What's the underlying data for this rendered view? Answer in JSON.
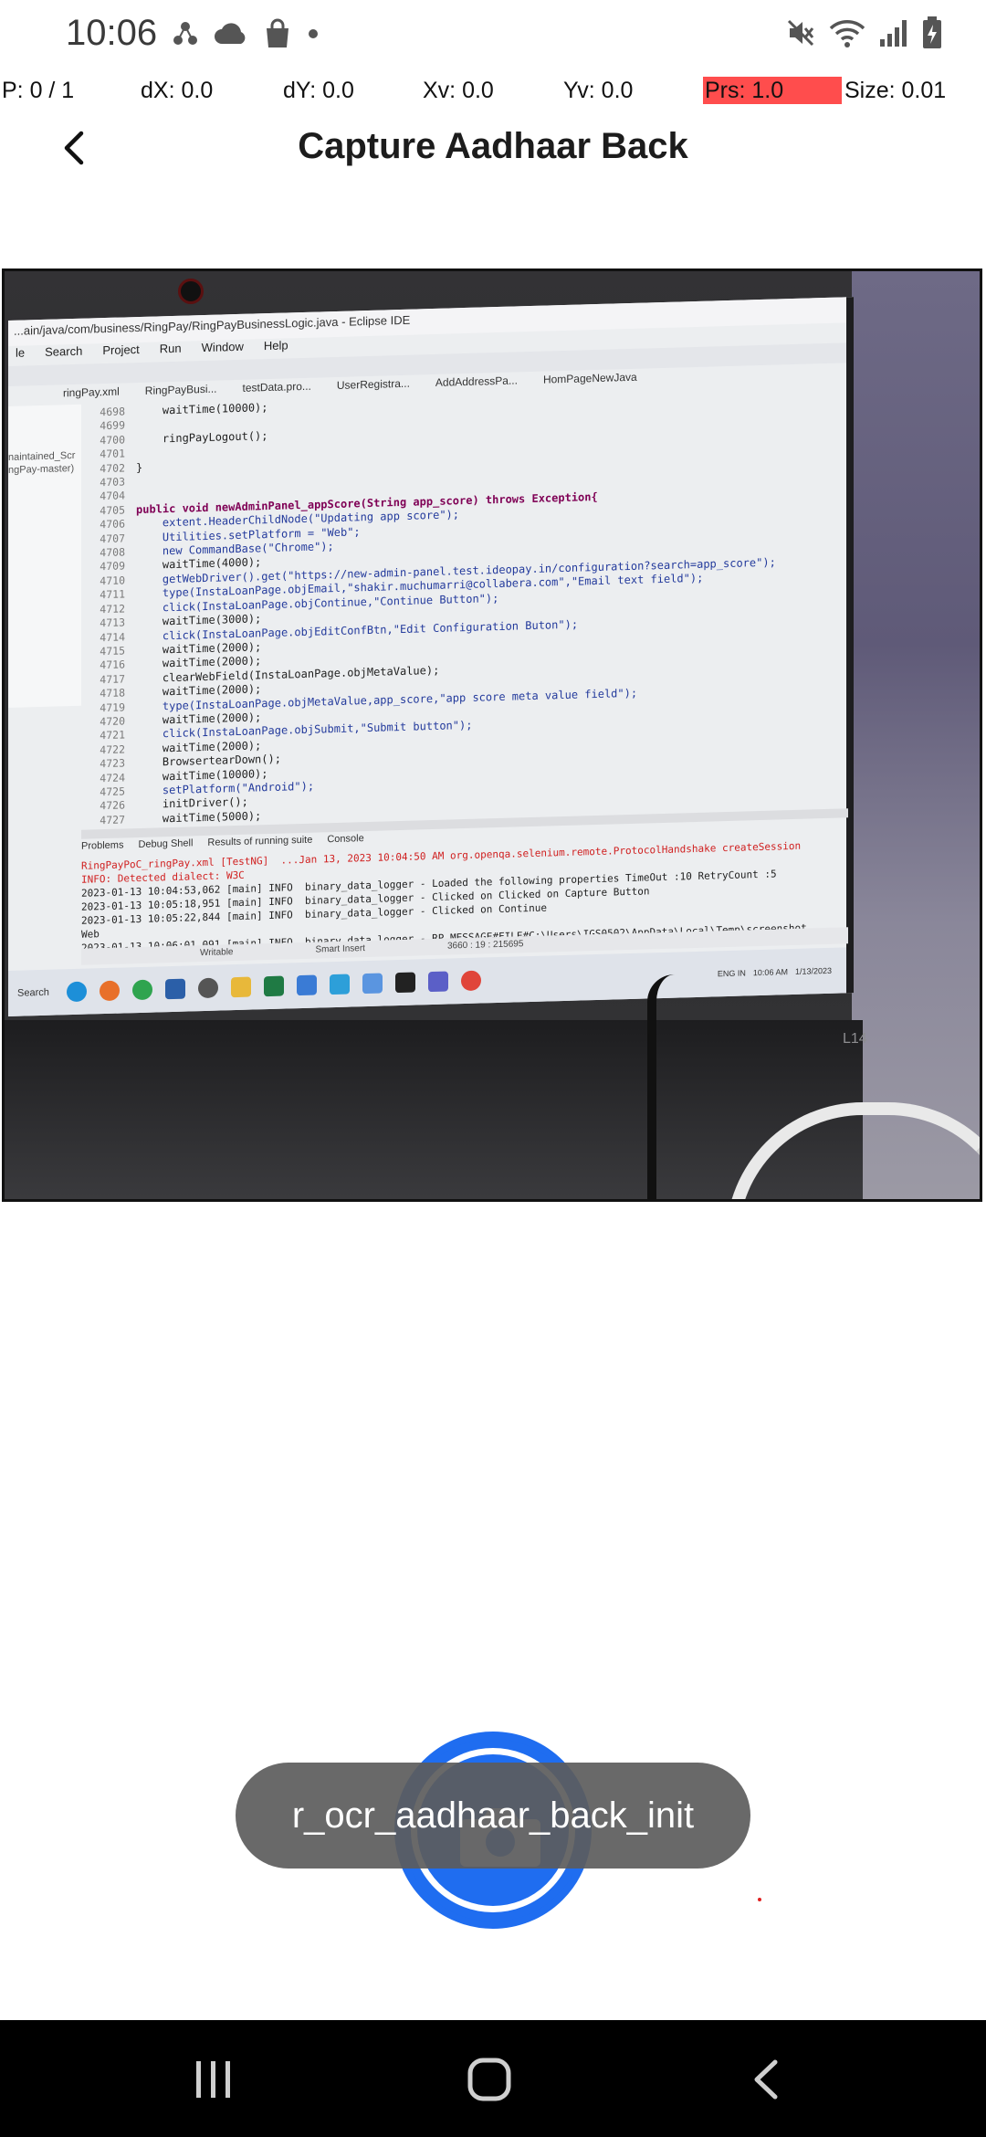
{
  "status_bar": {
    "time": "10:06",
    "left_icons": [
      "share-network-icon",
      "cloud-icon",
      "shopping-bag-icon",
      "dot-icon"
    ],
    "right_icons": [
      "mute-icon",
      "wifi-icon",
      "signal-icon",
      "battery-charging-icon"
    ]
  },
  "pointer_overlay": {
    "p": "P: 0 / 1",
    "dx": "dX: 0.0",
    "dy": "dY: 0.0",
    "xv": "Xv: 0.0",
    "yv": "Yv: 0.0",
    "prs": "Prs: 1.0",
    "size": "Size: 0.01",
    "prs_highlight_color": "#ff4d4d"
  },
  "header": {
    "back_icon": "chevron-left-icon",
    "title": "Capture Aadhaar Back"
  },
  "camera_preview": {
    "eclipse_title": "...ain/java/com/business/RingPay/RingPayBusinessLogic.java - Eclipse IDE",
    "menu": [
      "le",
      "Search",
      "Project",
      "Run",
      "Window",
      "Help"
    ],
    "editor_tabs": [
      "ringPay.xml",
      "RingPayBusi...",
      "testData.pro...",
      "UserRegistra...",
      "AddAddressPa...",
      "HomPageNewJava"
    ],
    "left_pane": [
      "naintained_Scr",
      "ngPay-master)"
    ],
    "line_numbers": [
      "4698",
      "4699",
      "4700",
      "4701",
      "4702",
      "4703",
      "4704",
      "4705",
      "4706",
      "4707",
      "4708",
      "4709",
      "4710",
      "4711",
      "4712",
      "4713",
      "4714",
      "4715",
      "4716",
      "4717",
      "4718",
      "4719",
      "4720",
      "4721",
      "4722",
      "4723",
      "4724",
      "4725",
      "4726",
      "4727"
    ],
    "code_lines": [
      "    waitTime(10000);",
      "",
      "    ringPayLogout();",
      "",
      "}",
      "",
      "",
      "public void newAdminPanel_appScore(String app_score) throws Exception{",
      "    extent.HeaderChildNode(\"Updating app score\");",
      "    Utilities.setPlatform = \"Web\";",
      "    new CommandBase(\"Chrome\");",
      "    waitTime(4000);",
      "    getWebDriver().get(\"https://new-admin-panel.test.ideopay.in/configuration?search=app_score\");",
      "    type(InstaLoanPage.objEmail,\"shakir.muchumarri@collabera.com\",\"Email text field\");",
      "    click(InstaLoanPage.objContinue,\"Continue Button\");",
      "    waitTime(3000);",
      "    click(InstaLoanPage.objEditConfBtn,\"Edit Configuration Buton\");",
      "    waitTime(2000);",
      "    waitTime(2000);",
      "    clearWebField(InstaLoanPage.objMetaValue);",
      "    waitTime(2000);",
      "    type(InstaLoanPage.objMetaValue,app_score,\"app score meta value field\");",
      "    waitTime(2000);",
      "    click(InstaLoanPage.objSubmit,\"Submit button\");",
      "    waitTime(2000);",
      "    BrowsertearDown();",
      "    waitTime(10000);",
      "    setPlatform(\"Android\");",
      "    initDriver();",
      "    waitTime(5000);"
    ],
    "console_tabs": [
      "Problems",
      "Debug Shell",
      "Results of running suite",
      "Console"
    ],
    "console_lines": [
      "RingPayPoC_ringPay.xml [TestNG]  ...Jan 13, 2023 10:04:50 AM org.openqa.selenium.remote.ProtocolHandshake createSession",
      "INFO: Detected dialect: W3C",
      "2023-01-13 10:04:53,062 [main] INFO  binary_data_logger - Loaded the following properties TimeOut :10 RetryCount :5",
      "2023-01-13 10:05:18,951 [main] INFO  binary_data_logger - Clicked on Clicked on Capture Button",
      "2023-01-13 10:05:22,844 [main] INFO  binary_data_logger - Clicked on Continue",
      "Web",
      "2023-01-13 10:06:01,091 [main] INFO  binary_data_logger - RP_MESSAGE#FILE#C:\\Users\\IGS0502\\AppData\\Local\\Temp\\screenshot"
    ],
    "status_line": [
      "Writable",
      "Smart Insert",
      "3660 : 19 : 215695"
    ],
    "taskbar_search": "Search",
    "taskbar_tray": [
      "ENG IN",
      "10:06 AM",
      "1/13/2023"
    ],
    "laptop_label": "L14"
  },
  "shutter": {
    "icon": "camera-icon",
    "color": "#1f6df0"
  },
  "toast": {
    "text": "r_ocr_aadhaar_back_init"
  },
  "nav_bar": {
    "recents_icon": "recents-icon",
    "home_icon": "home-icon",
    "back_icon": "back-arrow-icon"
  }
}
